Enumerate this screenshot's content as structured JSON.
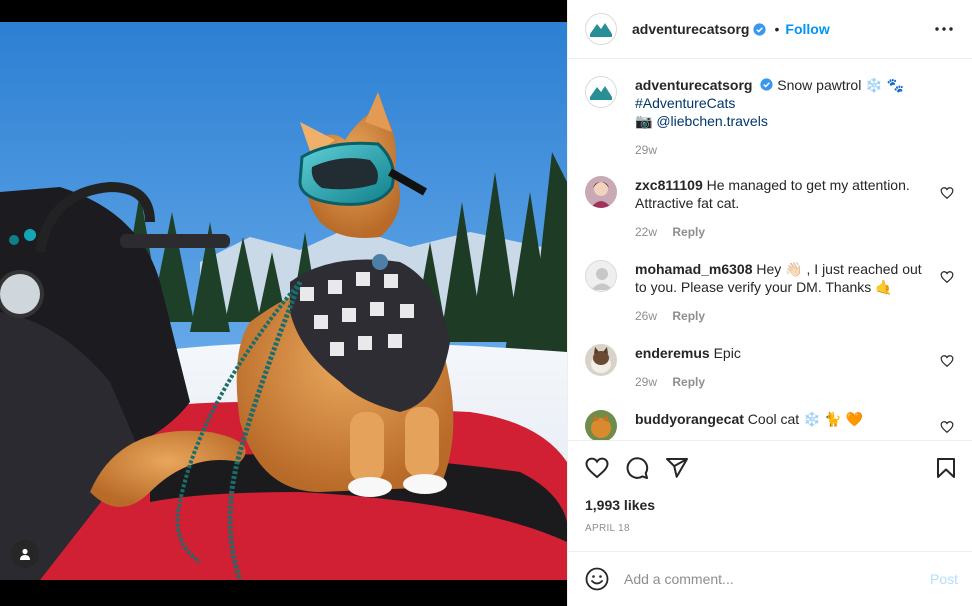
{
  "post": {
    "author": "adventurecatsorg",
    "follow_label": "Follow",
    "separator": "•",
    "caption_text": "Snow pawtrol",
    "caption_emoji": "❄️ 🐾",
    "hashtag": "#AdventureCats",
    "camera_emoji": "📷",
    "credit_handle": "@liebchen.travels",
    "caption_age": "29w",
    "likes": "1,993 likes",
    "date": "APRIL 18"
  },
  "comments": [
    {
      "user": "zxc811109",
      "text": "He managed to get my attention. Attractive fat cat.",
      "age": "22w",
      "reply": "Reply"
    },
    {
      "user": "mohamad_m6308",
      "text": "Hey 👋🏻 , I just reached out to you. Please verify your DM. Thanks 🤙",
      "age": "26w",
      "reply": "Reply"
    },
    {
      "user": "enderemus",
      "text": "Epic",
      "age": "29w",
      "reply": "Reply"
    },
    {
      "user": "buddyorangecat",
      "text": "Cool cat ❄️ 🐈 🧡",
      "age": "",
      "reply": ""
    }
  ],
  "composer": {
    "placeholder": "Add a comment...",
    "post_label": "Post"
  },
  "colors": {
    "accent": "#0095f6",
    "brand_teal": "#2a8f95",
    "like_red": "#ed4956"
  },
  "icons": [
    "verified-badge-icon",
    "more-options-icon",
    "heart-icon",
    "comment-icon",
    "share-icon",
    "bookmark-icon",
    "emoji-icon",
    "user-tag-icon"
  ]
}
